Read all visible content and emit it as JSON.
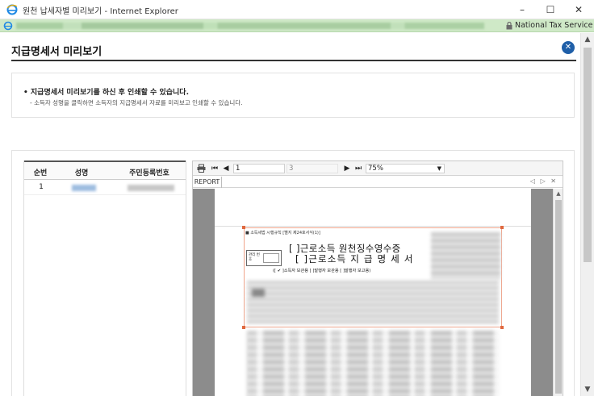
{
  "window": {
    "title": "원천 납세자별 미리보기 - Internet Explorer",
    "minimize": "–",
    "maximize": "☐",
    "close": "✕"
  },
  "address_bar": {
    "site_identity": "National Tax Service [KR]"
  },
  "page": {
    "title": "지급명세서 미리보기",
    "close_label": "✕"
  },
  "notice": {
    "headline": "• 지급명세서 미리보기를 하신 후 인쇄할 수 있습니다.",
    "detail": "- 소득자 성명을 클릭하면 소득자의 지급명세서 자료를 미리보고 인쇄할 수 있습니다."
  },
  "list": {
    "columns": [
      "순번",
      "성명",
      "주민등록번호"
    ],
    "rows": [
      {
        "no": "1"
      }
    ]
  },
  "viewer": {
    "current_page": "1",
    "total_pages": "3",
    "zoom": "75%",
    "tab_label": "REPORT",
    "tab_controls": "◁ ▷ ✕"
  },
  "report": {
    "caption": "■ 소득세법 시행규칙 [별지 제24호서식(1)]",
    "title_line1": "[  ]근로소득 원천징수영수증",
    "title_line2": "[  ]근로소득 지 급 명 세 서",
    "box_label": "관리 번호",
    "checks": "([ ✔ ]소득자 보관용    [  ]발행자 보관용    [  ]발행자 보고용)"
  },
  "colors": {
    "address_bar_bg": "#cfe9c7",
    "close_button": "#1f5fa8",
    "selection_border": "#e0683e"
  }
}
